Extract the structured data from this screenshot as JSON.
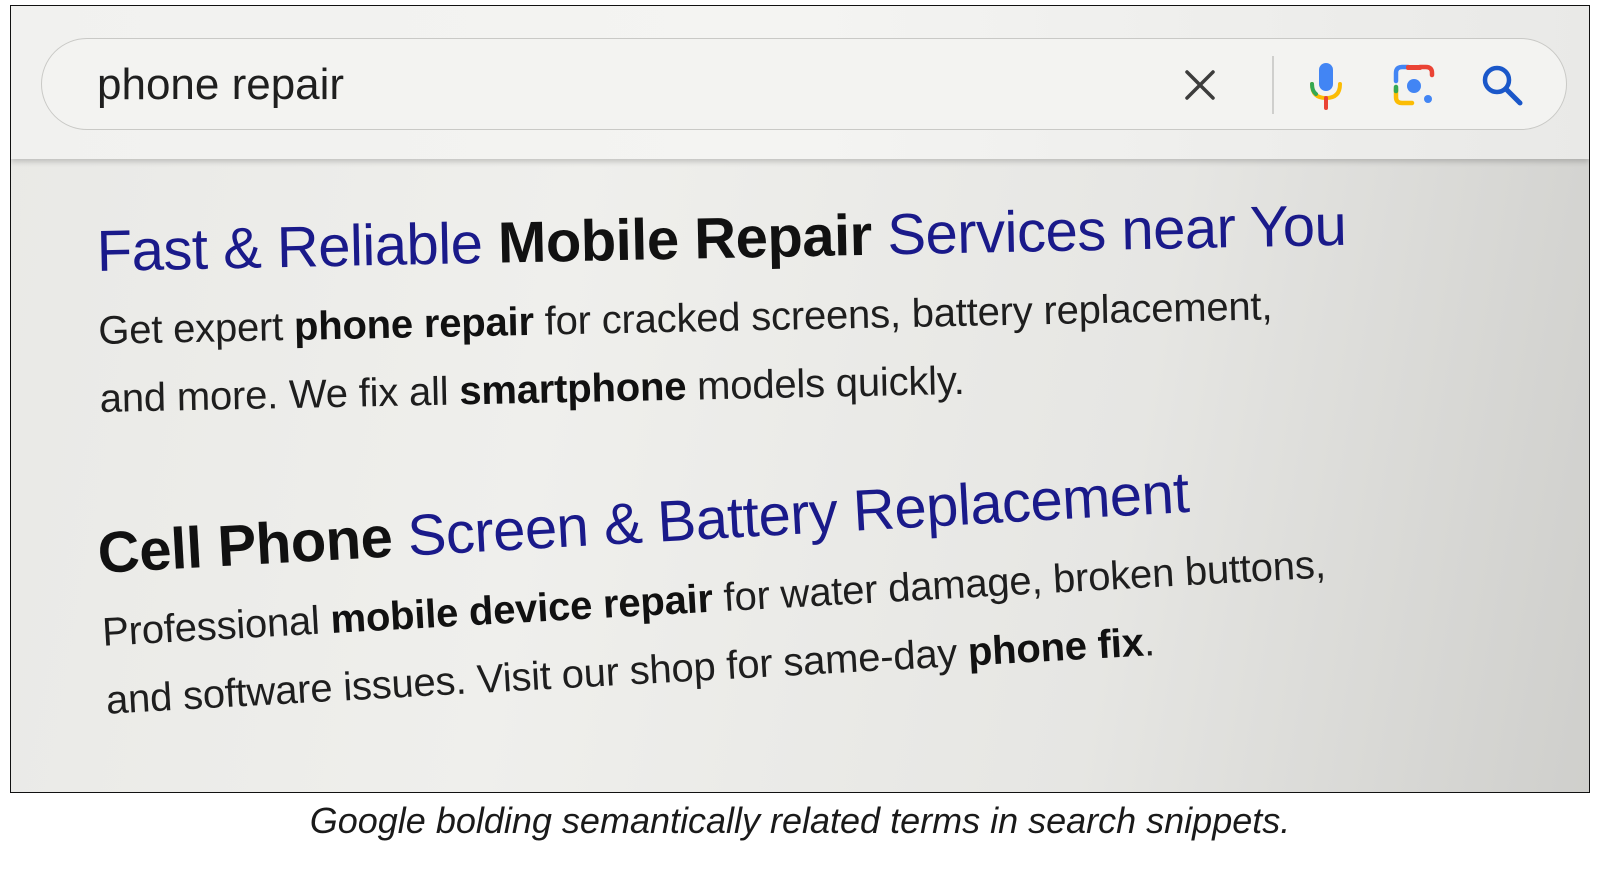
{
  "search": {
    "query": "phone repair",
    "icons": [
      "close-icon",
      "microphone-icon",
      "camera-lens-icon",
      "search-icon"
    ],
    "colors": {
      "mic_blue": "#4285F4",
      "mic_yellow": "#FBBC04",
      "mic_red": "#EA4335",
      "lens_red": "#EA4335",
      "lens_blue": "#4285F4",
      "lens_yellow": "#FBBC04",
      "lens_green": "#34A853",
      "search_blue": "#1a57c9"
    }
  },
  "results": [
    {
      "title_parts": [
        {
          "text": "Fast & Reliable ",
          "bold": false
        },
        {
          "text": "Mobile Repair",
          "bold": true
        },
        {
          "text": " Services near You",
          "bold": false
        }
      ],
      "snippet_lines": [
        [
          {
            "text": "Get expert ",
            "bold": false
          },
          {
            "text": "phone repair",
            "bold": true
          },
          {
            "text": " for cracked screens, battery replacement,",
            "bold": false
          }
        ],
        [
          {
            "text": "and more. We fix all ",
            "bold": false
          },
          {
            "text": "smartphone",
            "bold": true
          },
          {
            "text": " models quickly.",
            "bold": false
          }
        ]
      ]
    },
    {
      "title_parts": [
        {
          "text": "Cell Phone",
          "bold": true
        },
        {
          "text": " Screen & Battery Replacement",
          "bold": false
        }
      ],
      "snippet_lines": [
        [
          {
            "text": "Professional ",
            "bold": false
          },
          {
            "text": "mobile device repair",
            "bold": true
          },
          {
            "text": " for water damage, broken buttons,",
            "bold": false
          }
        ],
        [
          {
            "text": "and software issues. Visit our shop for same-day ",
            "bold": false
          },
          {
            "text": "phone fix",
            "bold": true
          },
          {
            "text": ".",
            "bold": false
          }
        ]
      ]
    }
  ],
  "caption": "Google bolding semantically related terms in search snippets.",
  "colors": {
    "title_blue": "#1a1a8a",
    "bold_text": "#111111"
  }
}
